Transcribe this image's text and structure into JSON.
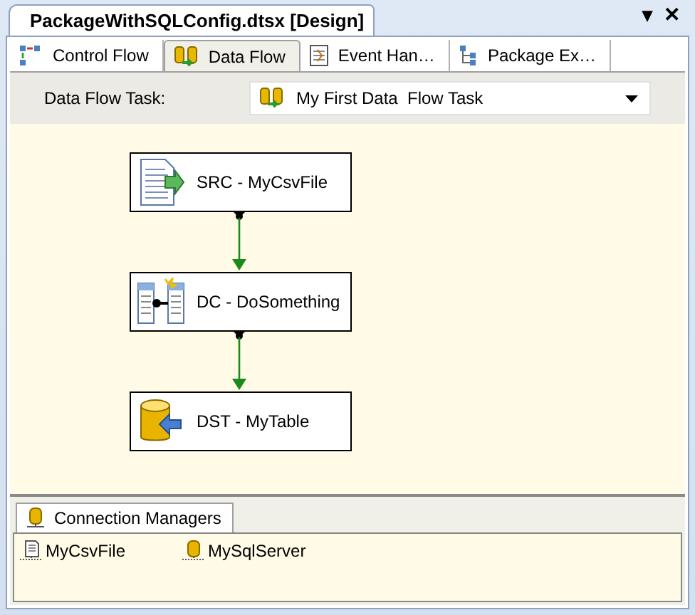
{
  "document_tab": {
    "title": "PackageWithSQLConfig.dtsx [Design]",
    "menu": "▾",
    "close": "✕"
  },
  "tabs": [
    {
      "label": "Control Flow",
      "kind": "control",
      "selected": false
    },
    {
      "label": "Data Flow",
      "kind": "data",
      "selected": true
    },
    {
      "label": "Event Han…",
      "kind": "event",
      "selected": false
    },
    {
      "label": "Package Ex…",
      "kind": "explorer",
      "selected": false
    }
  ],
  "task_bar": {
    "label": "Data Flow Task:",
    "value": "My First Data  Flow Task"
  },
  "nodes": [
    {
      "label": "SRC - MyCsvFile",
      "kind": "source"
    },
    {
      "label": "DC - DoSomething",
      "kind": "transform"
    },
    {
      "label": "DST - MyTable",
      "kind": "destination"
    }
  ],
  "connection_managers": {
    "title": "Connection Managers",
    "items": [
      {
        "label": "MyCsvFile",
        "kind": "file"
      },
      {
        "label": "MySqlServer",
        "kind": "database"
      }
    ]
  }
}
